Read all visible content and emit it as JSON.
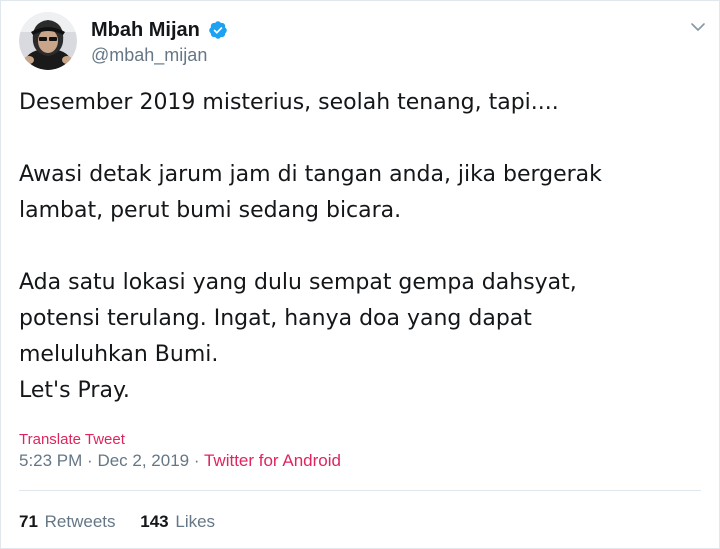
{
  "colors": {
    "accent": "#e0245e",
    "muted": "#657786",
    "verified": "#1da1f2",
    "text": "#14171a"
  },
  "user": {
    "display_name": "Mbah Mijan",
    "handle": "@mbah_mijan",
    "verified_icon": "verified-badge-icon",
    "avatar_icon": "profile-avatar"
  },
  "tweet": {
    "line1": "Desember 2019 misterius, seolah tenang, tapi....",
    "line2": "Awasi detak jarum jam di tangan anda, jika bergerak",
    "line3": "lambat, perut bumi sedang bicara.",
    "line4": "Ada satu lokasi yang dulu sempat gempa dahsyat,",
    "line5": "potensi terulang. Ingat, hanya doa yang dapat",
    "line6": "meluluhkan Bumi.",
    "line7": "Let's Pray."
  },
  "translate_label": "Translate Tweet",
  "meta": {
    "time": "5:23 PM",
    "separator1": "·",
    "date": "Dec 2, 2019",
    "separator2": "·",
    "source": "Twitter for Android"
  },
  "stats": {
    "retweets_count": "71",
    "retweets_label": "Retweets",
    "likes_count": "143",
    "likes_label": "Likes"
  },
  "menu_icon": "chevron-down-icon"
}
